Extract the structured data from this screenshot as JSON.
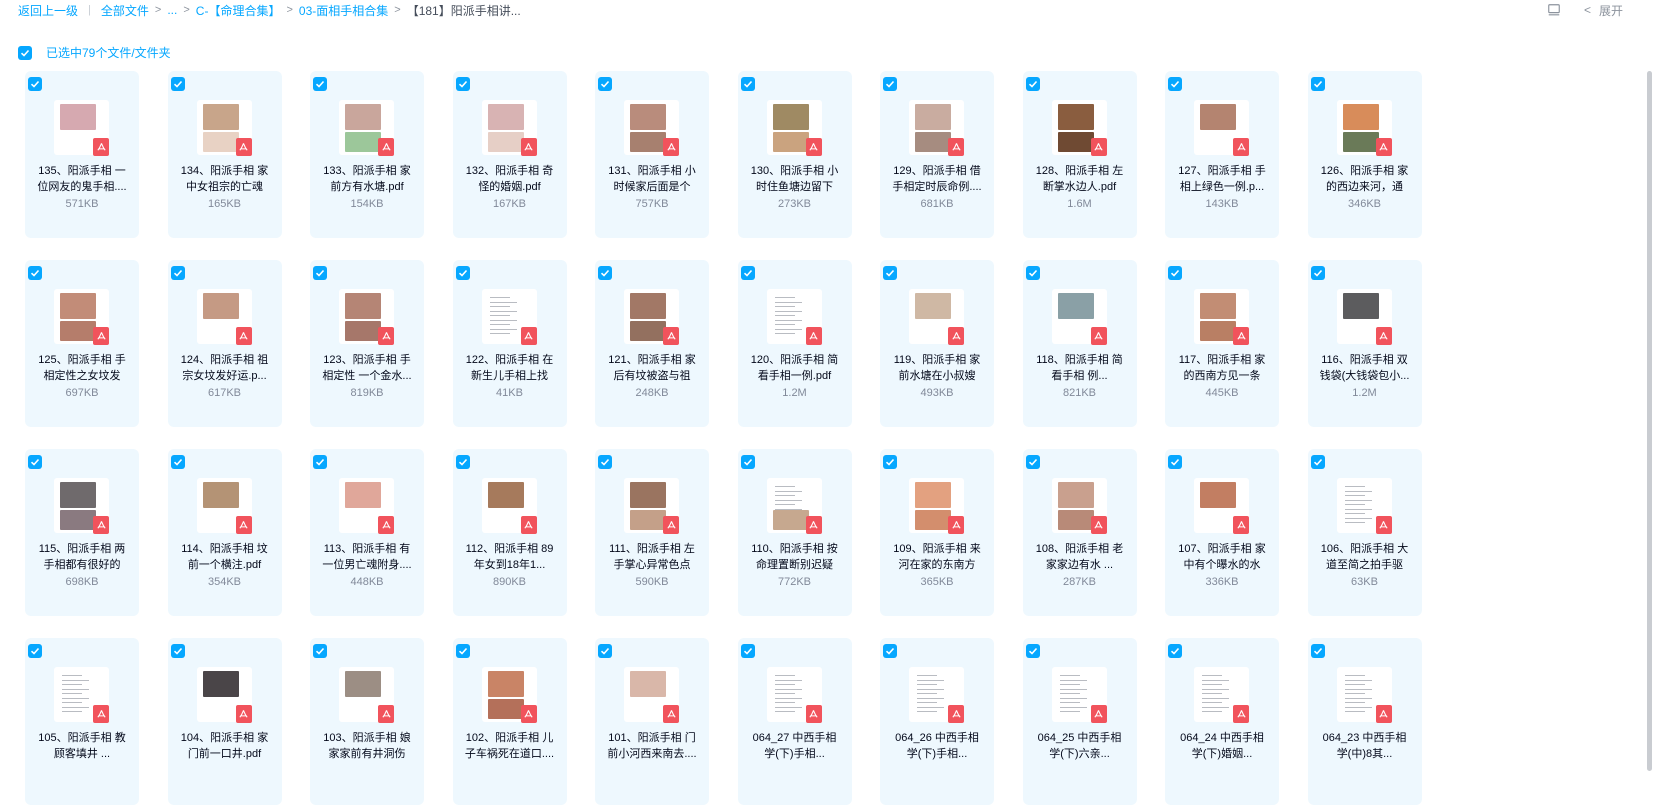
{
  "breadcrumb": {
    "back": "返回上一级",
    "items": [
      "全部文件",
      "...",
      "C-【命理合集】",
      "03-面相手相合集",
      "【181】阳派手相讲..."
    ]
  },
  "toolbar": {
    "expand_label": "展开",
    "list_icon": "list-view-icon",
    "chevron_icon": "chevron-left-icon"
  },
  "selection": {
    "label": "已选中79个文件/文件夹",
    "checked": true
  },
  "colors": {
    "accent": "#06a7ff",
    "card_bg": "#eef8fe",
    "pdf_red": "#f1535c"
  },
  "files": [
    {
      "name": "135、阳派手相 一位网友的鬼手相....",
      "size": "571KB",
      "thumb": [
        "#d6a9b0",
        ""
      ]
    },
    {
      "name": "134、阳派手相 家中女祖宗的亡魂",
      "size": "165KB",
      "thumb": [
        "#c8a58a",
        "#e8d2c4"
      ]
    },
    {
      "name": "133、阳派手相 家前方有水塘.pdf",
      "size": "154KB",
      "thumb": [
        "#c9a69c",
        "#9cc79a"
      ]
    },
    {
      "name": "132、阳派手相 奇怪的婚姻.pdf",
      "size": "167KB",
      "thumb": [
        "#d8b3b3",
        "#e6cfc6"
      ]
    },
    {
      "name": "131、阳派手相 小时候家后面是个",
      "size": "757KB",
      "thumb": [
        "#b98c7c",
        "#a7806f"
      ]
    },
    {
      "name": "130、阳派手相 小时住鱼塘边留下",
      "size": "273KB",
      "thumb": [
        "#9f8a63",
        "#caa37f"
      ]
    },
    {
      "name": "129、阳派手相 借手相定时辰命例....",
      "size": "681KB",
      "thumb": [
        "#c9aca0",
        "#a68c80"
      ]
    },
    {
      "name": "128、阳派手相 左断掌水边人.pdf",
      "size": "1.6M",
      "thumb": [
        "#8a5d3f",
        "#6f4a33"
      ]
    },
    {
      "name": "127、阳派手相 手相上绿色一例.p...",
      "size": "143KB",
      "thumb": [
        "#b48470",
        ""
      ]
    },
    {
      "name": "126、阳派手相 家的西边来河，通",
      "size": "346KB",
      "thumb": [
        "#d88c5a",
        "#6a7a58"
      ]
    },
    {
      "name": "125、阳派手相 手相定性之女坟发",
      "size": "697KB",
      "thumb": [
        "#c28c78",
        "#b57d6b"
      ]
    },
    {
      "name": "124、阳派手相 祖宗女坟发好运.p...",
      "size": "617KB",
      "thumb": [
        "#c59a84",
        ""
      ]
    },
    {
      "name": "123、阳派手相 手相定性 一个金水...",
      "size": "819KB",
      "thumb": [
        "#b58575",
        "#a6776a"
      ]
    },
    {
      "name": "122、阳派手相 在新生儿手相上找",
      "size": "41KB",
      "thumb": [
        "doc",
        ""
      ]
    },
    {
      "name": "121、阳派手相 家后有坟被盗与祖",
      "size": "248KB",
      "thumb": [
        "#a27866",
        "#93705f"
      ]
    },
    {
      "name": "120、阳派手相 简看手相一例.pdf",
      "size": "1.2M",
      "thumb": [
        "doc",
        ""
      ]
    },
    {
      "name": "119、阳派手相 家前水塘在小叔嫂",
      "size": "493KB",
      "thumb": [
        "#cfb8a4",
        ""
      ]
    },
    {
      "name": "118、阳派手相 简看手相 例...",
      "size": "821KB",
      "thumb": [
        "#8aa0a6",
        ""
      ]
    },
    {
      "name": "117、阳派手相 家的西南方见一条",
      "size": "445KB",
      "thumb": [
        "#c28d74",
        "#b97f64"
      ]
    },
    {
      "name": "116、阳派手相 双钱袋(大钱袋包小...",
      "size": "1.2M",
      "thumb": [
        "#5c5c5e",
        ""
      ]
    },
    {
      "name": "115、阳派手相 两手相都有很好的",
      "size": "698KB",
      "thumb": [
        "#6f6a6c",
        "#8a7a80"
      ]
    },
    {
      "name": "114、阳派手相 坟前一个横注.pdf",
      "size": "354KB",
      "thumb": [
        "#b49375",
        ""
      ]
    },
    {
      "name": "113、阳派手相 有一位男亡魂附身....",
      "size": "448KB",
      "thumb": [
        "#e0a79a",
        ""
      ]
    },
    {
      "name": "112、阳派手相 89年女到18年1...",
      "size": "890KB",
      "thumb": [
        "#a67a5c",
        ""
      ]
    },
    {
      "name": "111、阳派手相 左手掌心异常色点",
      "size": "590KB",
      "thumb": [
        "#9a7460",
        "#c4a089"
      ]
    },
    {
      "name": "110、阳派手相 按命理置断别迟疑",
      "size": "772KB",
      "thumb": [
        "doc",
        "#c6a88f"
      ]
    },
    {
      "name": "109、阳派手相 来河在家的东南方",
      "size": "365KB",
      "thumb": [
        "#e3a180",
        "#d38e6d"
      ]
    },
    {
      "name": "108、阳派手相 老家家边有水 ...",
      "size": "287KB",
      "thumb": [
        "#c9a08e",
        "#b88a78"
      ]
    },
    {
      "name": "107、阳派手相 家中有个曝水的水",
      "size": "336KB",
      "thumb": [
        "#c27e62",
        ""
      ]
    },
    {
      "name": "106、阳派手相 大道至简之拍手驱",
      "size": "63KB",
      "thumb": [
        "doc",
        ""
      ]
    },
    {
      "name": "105、阳派手相 教顾客填井 ...",
      "size": "",
      "thumb": [
        "doc",
        ""
      ]
    },
    {
      "name": "104、阳派手相 家门前一口井.pdf",
      "size": "",
      "thumb": [
        "#4a4548",
        ""
      ]
    },
    {
      "name": "103、阳派手相 娘家家前有井洞伤",
      "size": "",
      "thumb": [
        "#9c8e84",
        ""
      ]
    },
    {
      "name": "102、阳派手相 儿子车祸死在道口....",
      "size": "",
      "thumb": [
        "#c98466",
        "#b4705a"
      ]
    },
    {
      "name": "101、阳派手相 门前小河西来南去....",
      "size": "",
      "thumb": [
        "#d9b7a9",
        ""
      ]
    },
    {
      "name": "064_27 中西手相学(下)手相...",
      "size": "",
      "thumb": [
        "doc",
        ""
      ]
    },
    {
      "name": "064_26 中西手相学(下)手相...",
      "size": "",
      "thumb": [
        "doc",
        ""
      ]
    },
    {
      "name": "064_25 中西手相学(下)六亲...",
      "size": "",
      "thumb": [
        "doc",
        ""
      ]
    },
    {
      "name": "064_24 中西手相学(下)婚姻...",
      "size": "",
      "thumb": [
        "doc",
        ""
      ]
    },
    {
      "name": "064_23 中西手相学(中)8其...",
      "size": "",
      "thumb": [
        "doc",
        ""
      ]
    }
  ]
}
